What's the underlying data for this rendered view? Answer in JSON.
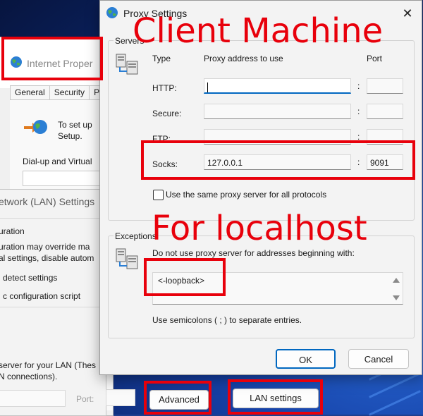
{
  "internet_properties": {
    "title": "Internet Proper",
    "tabs": [
      "General",
      "Security",
      "P"
    ],
    "setup_text": "To set up\nSetup.",
    "dialup_label": "Dial-up and Virtual",
    "advanced_button": "Advanced",
    "lan_settings_button": "LAN settings"
  },
  "lan_settings": {
    "title": "etwork (LAN) Settings",
    "lines": [
      "uration",
      "uration may override ma",
      "al settings, disable autom",
      "detect settings",
      "c configuration script",
      "server for your LAN (Thes",
      "N connections).",
      "Port:"
    ]
  },
  "proxy_settings": {
    "title": "Proxy Settings",
    "close_glyph": "✕",
    "servers": {
      "group_label": "Servers",
      "type_header": "Type",
      "address_header": "Proxy address to use",
      "port_header": "Port",
      "rows": [
        {
          "label": "HTTP:",
          "address": "",
          "port": ""
        },
        {
          "label": "Secure:",
          "address": "",
          "port": ""
        },
        {
          "label": "FTP:",
          "address": "",
          "port": ""
        },
        {
          "label": "Socks:",
          "address": "127.0.0.1",
          "port": "9091"
        }
      ],
      "colon": ":",
      "same_proxy_label": "Use the same proxy server for all protocols",
      "same_proxy_checked": false
    },
    "exceptions": {
      "group_label": "Exceptions",
      "instruction": "Do not use proxy server for addresses beginning with:",
      "value": "<-loopback>",
      "note": "Use semicolons ( ; ) to separate entries."
    },
    "ok_button": "OK",
    "cancel_button": "Cancel"
  },
  "annotations": {
    "client_machine": "Client Machine",
    "for_localhost": "For localhost",
    "color": "#e8000b"
  }
}
